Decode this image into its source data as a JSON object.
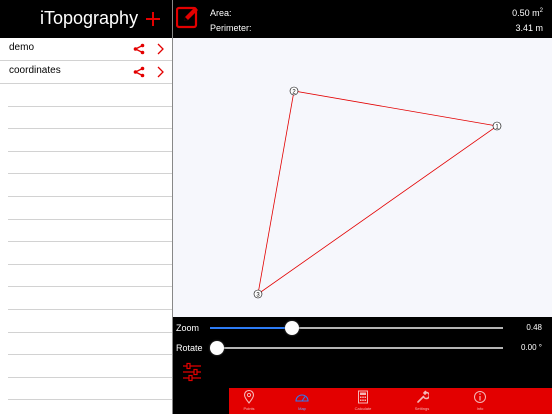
{
  "app": {
    "title": "iTopography"
  },
  "sidebar": {
    "items": [
      {
        "label": "demo"
      },
      {
        "label": "coordinates"
      }
    ]
  },
  "header": {
    "area_label": "Area:",
    "area_value": "0.50 m",
    "area_unit_exp": "2",
    "perimeter_label": "Perimeter:",
    "perimeter_value": "3.41 m"
  },
  "map": {
    "points": [
      {
        "label": "1"
      },
      {
        "label": "2"
      },
      {
        "label": "3"
      }
    ],
    "line_color": "#e30000"
  },
  "controls": {
    "zoom_label": "Zoom",
    "zoom_value": "0.48",
    "zoom_fraction": 0.28,
    "rotate_label": "Rotate",
    "rotate_value": "0.00 °",
    "rotate_fraction": 0.0
  },
  "tabs": [
    {
      "label": "Points",
      "icon": "location-pin-icon"
    },
    {
      "label": "Map",
      "icon": "protractor-icon",
      "active": true
    },
    {
      "label": "Calculate",
      "icon": "calculator-icon"
    },
    {
      "label": "Settings",
      "icon": "wrench-icon"
    },
    {
      "label": "Info",
      "icon": "info-icon"
    }
  ],
  "colors": {
    "accent": "#e30000",
    "active_tab": "#2d7cf6",
    "slider_fill": "#2d7cf6"
  }
}
